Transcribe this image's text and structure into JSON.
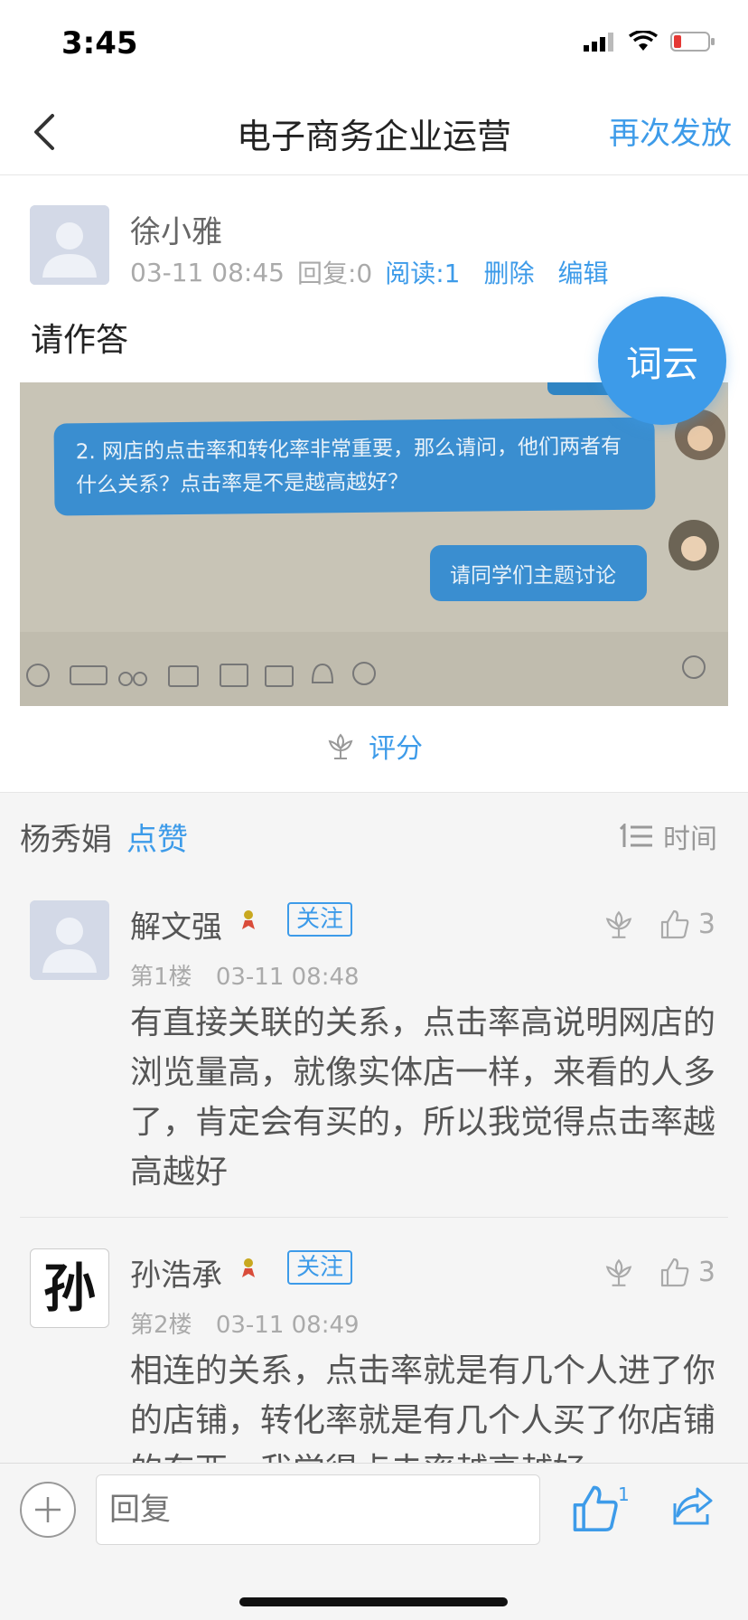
{
  "status_bar": {
    "time": "3:45"
  },
  "nav": {
    "title": "电子商务企业运营",
    "action": "再次发放"
  },
  "post": {
    "author": "徐小雅",
    "date": "03-11 08:45",
    "replies": "回复:0",
    "reads": "阅读:1",
    "delete": "删除",
    "edit": "编辑",
    "body": "请作答",
    "image_chat": {
      "question": "2. 网店的点击率和转化率非常重要，那么请问，他们两者有什么关系？点击率是不是越高越好？",
      "reply": "请同学们主题讨论"
    },
    "rate_label": "评分"
  },
  "fab_label": "词云",
  "likes_bar": {
    "names": "杨秀娟",
    "like_word": "点赞",
    "sort_label": "时间"
  },
  "comments": [
    {
      "name": "解文强",
      "follow": "关注",
      "floor": "第1楼",
      "date": "03-11 08:48",
      "likes": "3",
      "text": "有直接关联的关系，点击率高说明网店的浏览量高，就像实体店一样，来看的人多了，肯定会有买的，所以我觉得点击率越高越好"
    },
    {
      "name": "孙浩承",
      "follow": "关注",
      "floor": "第2楼",
      "date": "03-11 08:49",
      "likes": "3",
      "avatar_char": "孙",
      "text": "相连的关系，点击率就是有几个人进了你的店铺，转化率就是有几个人买了你店铺的东西，我觉得点击率越高越好"
    }
  ],
  "bottom_bar": {
    "reply_placeholder": "回复",
    "like_count": "1"
  },
  "colors": {
    "accent": "#3d9be9",
    "background": "#f5f5f5"
  }
}
